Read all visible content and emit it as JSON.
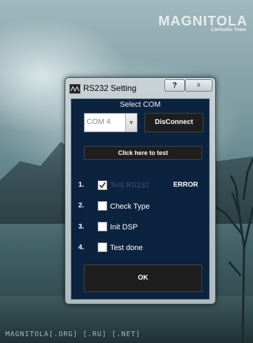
{
  "watermark": {
    "top": "MAGNITOLA",
    "top_sub": "CarAudio Team",
    "bottom": "MAGNITOLA[.ORG] [.RU] [.NET]"
  },
  "window": {
    "title": "RS232 Setting",
    "help_label": "?",
    "close_label": "x"
  },
  "com": {
    "section_label": "Select COM",
    "selected": "COM 4",
    "disconnect_label": "DisConnect"
  },
  "test_button_label": "Click here to test",
  "steps": [
    {
      "number": "1.",
      "label": "Test RS232",
      "checked": true,
      "enabled": false
    },
    {
      "number": "2.",
      "label": "Check Type",
      "checked": false,
      "enabled": true
    },
    {
      "number": "3.",
      "label": "Init DSP",
      "checked": false,
      "enabled": true
    },
    {
      "number": "4.",
      "label": "Test done",
      "checked": false,
      "enabled": true
    }
  ],
  "status_text": "ERROR",
  "ok_label": "OK",
  "colors": {
    "client_bg": "#0c2340",
    "button_bg": "#1e1e1e"
  }
}
